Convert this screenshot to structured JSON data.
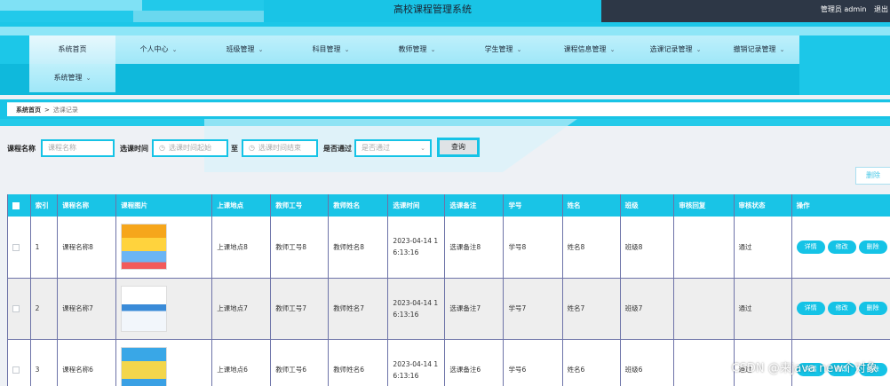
{
  "header": {
    "title": "高校课程管理系统",
    "user_text": "管理员 admin",
    "logout": "退出"
  },
  "nav": {
    "items": [
      {
        "label": "系统首页",
        "dropdown": false
      },
      {
        "label": "个人中心",
        "dropdown": true
      },
      {
        "label": "班级管理",
        "dropdown": true
      },
      {
        "label": "科目管理",
        "dropdown": true
      },
      {
        "label": "教师管理",
        "dropdown": true
      },
      {
        "label": "学生管理",
        "dropdown": true
      },
      {
        "label": "课程信息管理",
        "dropdown": true
      },
      {
        "label": "选课记录管理",
        "dropdown": true
      },
      {
        "label": "撤销记录管理",
        "dropdown": true
      },
      {
        "label": "系统管理",
        "dropdown": true
      }
    ],
    "chevron": "⌄"
  },
  "breadcrumb": {
    "home": "系统首页",
    "separator": ">",
    "current": "选课记录"
  },
  "search": {
    "course_label": "课程名称",
    "course_placeholder": "课程名称",
    "time_label": "选课时间",
    "time_start_placeholder": "选课时间起始",
    "time_sep": "至",
    "time_end_placeholder": "选课时间结束",
    "pass_label": "是否通过",
    "pass_placeholder": "是否通过",
    "query_button": "查询"
  },
  "toolbar": {
    "delete_button": "删除"
  },
  "table": {
    "headers": [
      "",
      "索引",
      "课程名称",
      "课程图片",
      "上课地点",
      "教师工号",
      "教师姓名",
      "选课时间",
      "选课备注",
      "学号",
      "姓名",
      "班级",
      "审核回复",
      "审核状态",
      "操作"
    ],
    "rows": [
      {
        "index": "1",
        "course_name": "课程名称8",
        "image": "thumb-a",
        "location": "上课地点8",
        "teacher_no": "教师工号8",
        "teacher_name": "教师姓名8",
        "time_line1": "2023-04-14 1",
        "time_line2": "6:13:16",
        "remark": "选课备注8",
        "student_no": "学号8",
        "name": "姓名8",
        "class": "班级8",
        "reply": "",
        "status": "通过"
      },
      {
        "index": "2",
        "course_name": "课程名称7",
        "image": "thumb-b",
        "location": "上课地点7",
        "teacher_no": "教师工号7",
        "teacher_name": "教师姓名7",
        "time_line1": "2023-04-14 1",
        "time_line2": "6:13:16",
        "remark": "选课备注7",
        "student_no": "学号7",
        "name": "姓名7",
        "class": "班级7",
        "reply": "",
        "status": "通过"
      },
      {
        "index": "3",
        "course_name": "课程名称6",
        "image": "thumb-c",
        "location": "上课地点6",
        "teacher_no": "教师工号6",
        "teacher_name": "教师姓名6",
        "time_line1": "2023-04-14 1",
        "time_line2": "6:13:16",
        "remark": "选课备注6",
        "student_no": "学号6",
        "name": "姓名6",
        "class": "班级6",
        "reply": "",
        "status": "通过"
      }
    ],
    "actions": {
      "detail": "详情",
      "edit": "修改",
      "delete": "删除"
    }
  },
  "watermark": "CSDN @来java new个对象",
  "colors": {
    "accent": "#19c4e6",
    "dark": "#2d3746"
  }
}
